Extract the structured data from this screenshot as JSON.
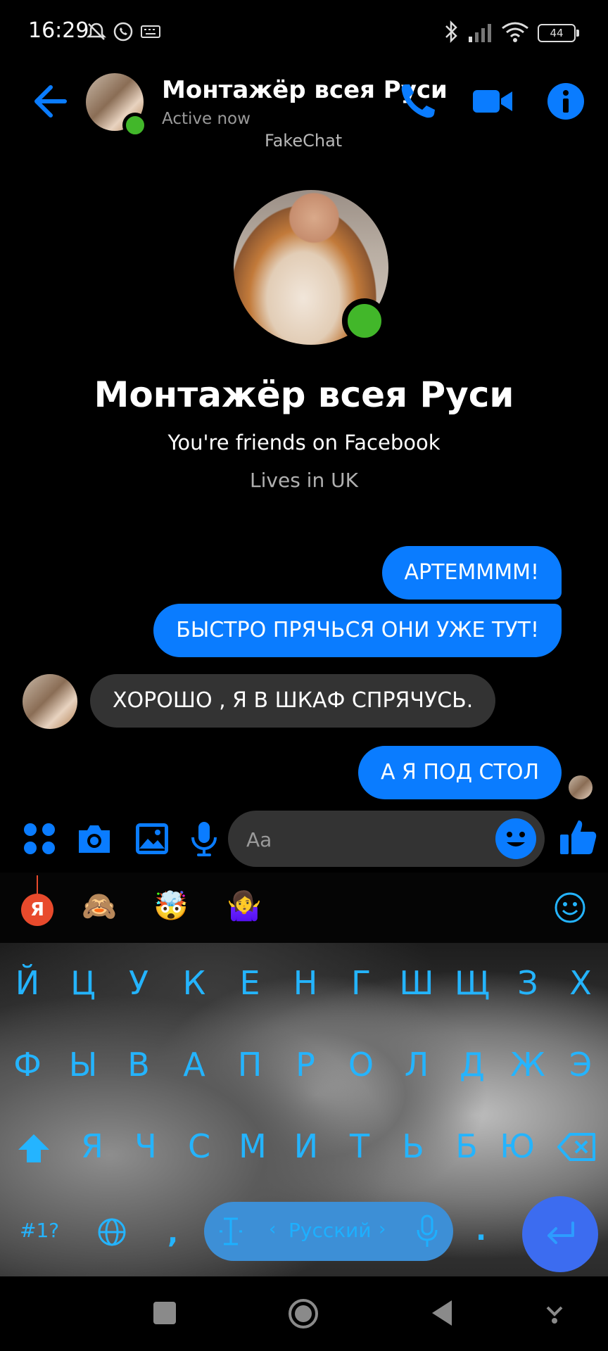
{
  "status_bar": {
    "time": "16:29",
    "battery": "44"
  },
  "header": {
    "contact_name": "Монтажёр всея Руси",
    "status": "Active now",
    "watermark": "FakeChat"
  },
  "profile": {
    "name": "Монтажёр всея Руси",
    "friends_line": "You're friends on Facebook",
    "location": "Lives in UK"
  },
  "messages": [
    {
      "text": "АРТЕММММ!",
      "direction": "outgoing"
    },
    {
      "text": "БЫСТРО ПРЯЧЬСЯ ОНИ УЖЕ ТУТ!",
      "direction": "outgoing"
    },
    {
      "text": "ХОРОШО , Я В ШКАФ СПРЯЧУСЬ.",
      "direction": "incoming"
    },
    {
      "text": "А Я ПОД СТОЛ",
      "direction": "outgoing"
    }
  ],
  "composer": {
    "placeholder": "Aa"
  },
  "keyboard": {
    "emoji_suggestions": [
      "🙈",
      "🤯",
      "🤷‍♀️"
    ],
    "yandex_badge": "Я",
    "row1": [
      "Й",
      "Ц",
      "У",
      "К",
      "Е",
      "Н",
      "Г",
      "Ш",
      "Щ",
      "З",
      "Х"
    ],
    "row2": [
      "Ф",
      "Ы",
      "В",
      "А",
      "П",
      "Р",
      "О",
      "Л",
      "Д",
      "Ж",
      "Э"
    ],
    "row3": [
      "Я",
      "Ч",
      "С",
      "М",
      "И",
      "Т",
      "Ь",
      "Б",
      "Ю"
    ],
    "symbols_key": "#1?",
    "comma_key": ",",
    "period_key": ".",
    "language": "Русский"
  },
  "colors": {
    "accent": "#0a7cff",
    "online": "#42b72a",
    "key_text": "#24b4ff"
  }
}
